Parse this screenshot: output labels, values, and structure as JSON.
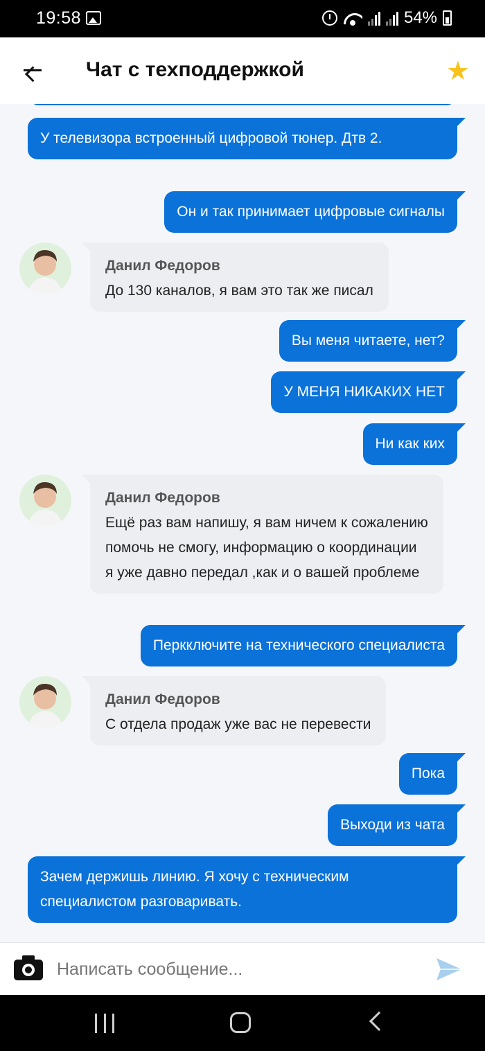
{
  "status_bar": {
    "time": "19:58",
    "battery": "54%"
  },
  "header": {
    "title": "Чат с техподдержкой",
    "back_icon": "arrow-left-icon",
    "star_icon": "star-icon",
    "star_color": "#f7c21a"
  },
  "colors": {
    "outgoing_bubble": "#0a72d9",
    "incoming_bubble": "#eceef2",
    "background": "#f5f6fa"
  },
  "messages": [
    {
      "from": "me",
      "text": "У телевизора встроенный цифровой тюнер. Дтв 2."
    },
    {
      "from": "me",
      "text": "Он и так принимает цифровые сигналы"
    },
    {
      "from": "support",
      "sender": "Данил Федоров",
      "text": "До 130 каналов, я вам это так же писал"
    },
    {
      "from": "me",
      "text": "Вы меня читаете, нет?"
    },
    {
      "from": "me",
      "text": "У МЕНЯ НИКАКИХ НЕТ"
    },
    {
      "from": "me",
      "text": "Ни как ких"
    },
    {
      "from": "support",
      "sender": "Данил Федоров",
      "text": "Ещё раз вам напишу, я вам ничем к сожалению помочь не смогу, информацию о координации я уже давно передал ,как и о вашей проблеме"
    },
    {
      "from": "me",
      "text": "Перкключите на технического специалиста"
    },
    {
      "from": "support",
      "sender": "Данил Федоров",
      "text": "С отдела продаж уже вас не перевести"
    },
    {
      "from": "me",
      "text": "Пока"
    },
    {
      "from": "me",
      "text": "Выходи из чата"
    },
    {
      "from": "me",
      "text": "Зачем держишь линию. Я хочу с техническим специалистом разговаривать."
    }
  ],
  "input": {
    "placeholder": "Написать сообщение...",
    "value": ""
  }
}
